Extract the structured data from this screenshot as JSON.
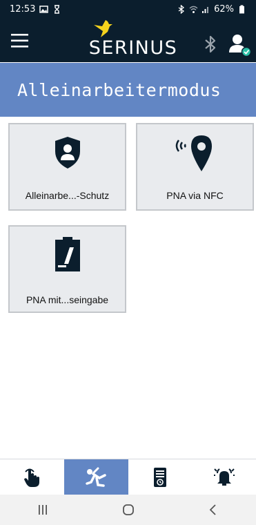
{
  "status_bar": {
    "time": "12:53",
    "battery": "62%",
    "left_icons": [
      "image-icon",
      "hourglass-icon"
    ],
    "right_icons": [
      "bluetooth-icon",
      "wifi-icon",
      "signal-icon",
      "battery-icon"
    ]
  },
  "header": {
    "brand": "SERINUS",
    "icons": [
      "menu-icon",
      "bird-logo-icon",
      "bluetooth-icon",
      "user-verified-icon"
    ]
  },
  "page": {
    "title": "Alleinarbeitermodus"
  },
  "tiles": [
    {
      "label": "Alleinarbe...-Schutz",
      "icon": "shield-user-icon"
    },
    {
      "label": "PNA via NFC",
      "icon": "nfc-location-icon"
    },
    {
      "label": "PNA mit...seingabe",
      "icon": "clipboard-edit-icon"
    }
  ],
  "tabs": [
    {
      "icon": "touch-hand-icon",
      "active": false
    },
    {
      "icon": "falling-person-icon",
      "active": true
    },
    {
      "icon": "device-timer-icon",
      "active": false
    },
    {
      "icon": "alarm-bell-icon",
      "active": false
    }
  ],
  "android_nav": [
    "recents-icon",
    "home-icon",
    "back-icon"
  ],
  "colors": {
    "header_bg": "#0b1e2d",
    "accent_blue": "#6286c4",
    "logo_yellow": "#f5d31d",
    "tile_bg": "#e9ebee",
    "badge_teal": "#2bbfa6"
  }
}
